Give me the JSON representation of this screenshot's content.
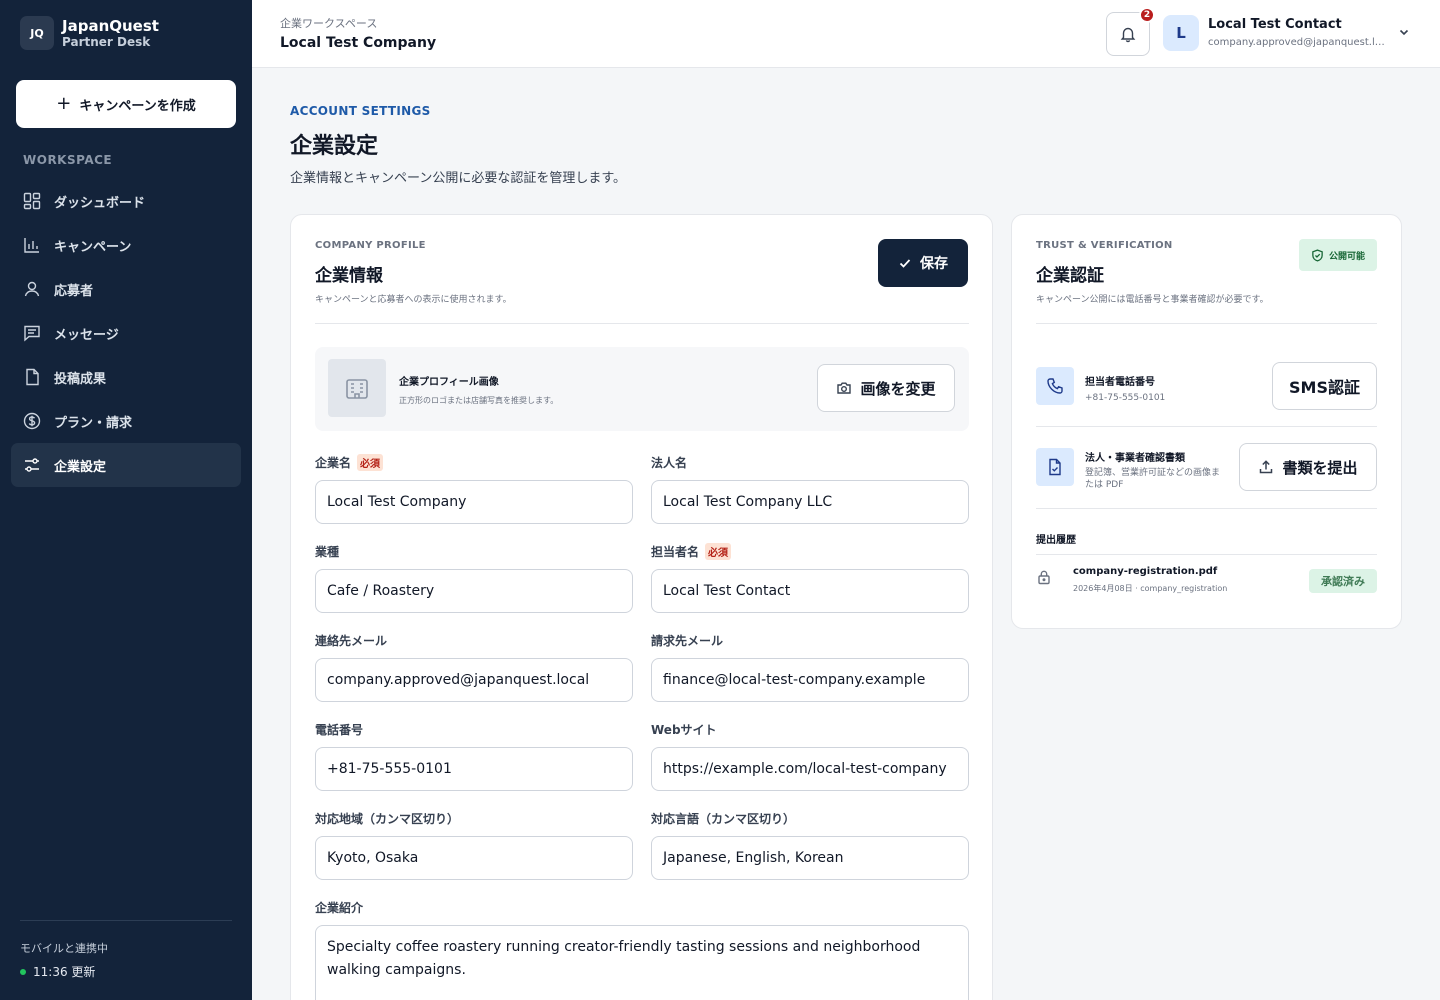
{
  "brand": {
    "logo": "JQ",
    "name": "JapanQuest",
    "sub": "Partner Desk"
  },
  "sidebar": {
    "create_label": "キャンペーンを作成",
    "section_label": "WORKSPACE",
    "items": [
      {
        "label": "ダッシュボード",
        "icon": "dashboard-icon"
      },
      {
        "label": "キャンペーン",
        "icon": "chart-icon"
      },
      {
        "label": "応募者",
        "icon": "user-icon"
      },
      {
        "label": "メッセージ",
        "icon": "message-icon"
      },
      {
        "label": "投稿成果",
        "icon": "file-icon"
      },
      {
        "label": "プラン・請求",
        "icon": "dollar-icon"
      },
      {
        "label": "企業設定",
        "icon": "settings-icon",
        "active": true
      }
    ],
    "sync_text": "モバイルと連携中",
    "updated_text": "11:36 更新"
  },
  "header": {
    "workspace_label": "企業ワークスペース",
    "company_name": "Local Test Company",
    "notification_count": "2",
    "avatar_letter": "L",
    "user_name": "Local Test Contact",
    "user_email": "company.approved@japanquest.local"
  },
  "page": {
    "eyebrow": "ACCOUNT SETTINGS",
    "title": "企業設定",
    "description": "企業情報とキャンペーン公開に必要な認証を管理します。"
  },
  "profile": {
    "eyebrow": "COMPANY PROFILE",
    "title": "企業情報",
    "description": "キャンペーンと応募者への表示に使用されます。",
    "save_label": "保存",
    "image_title": "企業プロフィール画像",
    "image_desc": "正方形のロゴまたは店舗写真を推奨します。",
    "image_button": "画像を変更",
    "required_tag": "必須",
    "fields": {
      "company_name": {
        "label": "企業名",
        "value": "Local Test Company"
      },
      "legal_name": {
        "label": "法人名",
        "value": "Local Test Company LLC"
      },
      "industry": {
        "label": "業種",
        "value": "Cafe / Roastery"
      },
      "contact_name": {
        "label": "担当者名",
        "value": "Local Test Contact"
      },
      "contact_email": {
        "label": "連絡先メール",
        "value": "company.approved@japanquest.local"
      },
      "billing_email": {
        "label": "請求先メール",
        "value": "finance@local-test-company.example"
      },
      "phone": {
        "label": "電話番号",
        "value": "+81-75-555-0101"
      },
      "website": {
        "label": "Webサイト",
        "value": "https://example.com/local-test-company"
      },
      "regions": {
        "label": "対応地域（カンマ区切り）",
        "value": "Kyoto, Osaka"
      },
      "languages": {
        "label": "対応言語（カンマ区切り）",
        "value": "Japanese, English, Korean"
      },
      "intro": {
        "label": "企業紹介",
        "value": "Specialty coffee roastery running creator-friendly tasting sessions and neighborhood walking campaigns."
      }
    }
  },
  "verification": {
    "eyebrow": "TRUST & VERIFICATION",
    "title": "企業認証",
    "description": "キャンペーン公開には電話番号と事業者確認が必要です。",
    "status_badge": "公開可能",
    "phone_title": "担当者電話番号",
    "phone_value": "+81-75-555-0101",
    "sms_button": "SMS認証",
    "doc_title": "法人・事業者確認書類",
    "doc_desc": "登記簿、営業許可証などの画像または PDF",
    "doc_button": "書類を提出",
    "history_title": "提出履歴",
    "history": [
      {
        "file": "company-registration.pdf",
        "meta": "2026年4月08日 · company_registration",
        "status": "承認済み"
      }
    ]
  },
  "colors": {
    "sidebar_bg": "#13233a",
    "accent_blue": "#1e5aa8",
    "success_bg": "#dcf3e6",
    "required_bg": "#fde2d4"
  }
}
